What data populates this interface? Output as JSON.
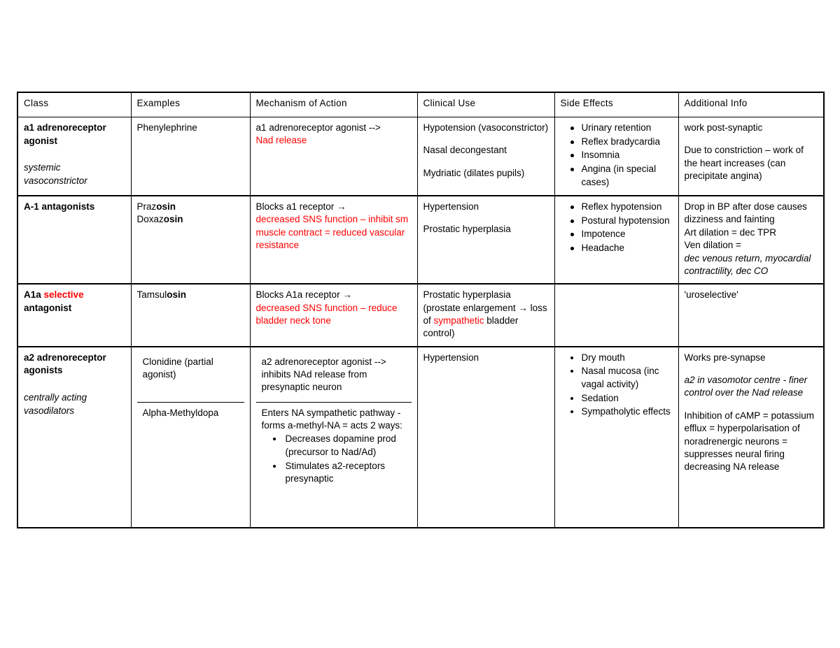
{
  "document": {
    "type": "reference-table",
    "accent_red": "#ff0000",
    "text_color": "#000000",
    "background": "#ffffff"
  },
  "table": {
    "headers": [
      "Class",
      "Examples",
      "Mechanism of Action",
      "Clinical Use",
      "Side Effects",
      "Additional Info"
    ],
    "rows": [
      {
        "class_title": "a1 adrenoreceptor agonist",
        "class_subtitle": "systemic vasoconstrictor",
        "examples": "Phenylephrine",
        "moa_black": "a1 adrenoreceptor agonist -->",
        "moa_red": "Nad release",
        "clinical_use": [
          "Hypotension (vasoconstrictor)",
          "Nasal decongestant",
          "Mydriatic (dilates pupils)"
        ],
        "side_effects": [
          "Urinary retention",
          "Reflex bradycardia",
          "Insomnia",
          "Angina (in special cases)"
        ],
        "additional_info": [
          "work post-synaptic",
          "Due to constriction – work of the heart increases (can precipitate angina)"
        ]
      },
      {
        "class_title": "A-1 antagonists",
        "examples_1_prefix": "Praz",
        "examples_1_bold": "osin",
        "examples_2_prefix": "Doxaz",
        "examples_2_bold": "osin",
        "moa_black": "Blocks a1 receptor →",
        "moa_red": "decreased SNS function – inhibit sm muscle contract = reduced vascular resistance",
        "clinical_use": [
          "Hypertension",
          "Prostatic hyperplasia"
        ],
        "side_effects": [
          "Reflex hypotension",
          "Postural hypotension",
          "Impotence",
          "Headache"
        ],
        "additional_plain": "Drop in BP after dose causes dizziness and fainting",
        "additional_line2": "Art dilation = dec TPR",
        "additional_line3": "Ven dilation =",
        "additional_italic": "dec venous return, myocardial contractility, dec CO"
      },
      {
        "class_title_part1": "A1a",
        "class_title_red": "selective",
        "class_title_part2": "antagonist",
        "examples_prefix": "Tamsul",
        "examples_bold": "osin",
        "moa_black": "Blocks A1a receptor →",
        "moa_red": "decreased SNS function – reduce bladder neck tone",
        "clinical_use_part1": "Prostatic hyperplasia (prostate enlargement → loss of ",
        "clinical_use_red": "sympathetic",
        "clinical_use_part2": " bladder control)",
        "side_effects": [],
        "additional_info": "'uroselective'"
      },
      {
        "class_title": "a2 adrenoreceptor agonists",
        "class_subtitle": "centrally acting vasodilators",
        "examples_a": "Clonidine (partial agonist)",
        "examples_b": "Alpha-Methyldopa",
        "moa_a": "a2 adrenoreceptor agonist --> inhibits NAd release from presynaptic neuron",
        "moa_b_intro": "Enters NA sympathetic pathway - forms a-methyl-NA = acts 2 ways:",
        "moa_b_bullets": [
          "Decreases dopamine prod (precursor to Nad/Ad)",
          "Stimulates a2-receptors presynaptic"
        ],
        "clinical_use": "Hypertension",
        "side_effects": [
          "Dry mouth",
          "Nasal mucosa (inc vagal activity)",
          "Sedation",
          "Sympatholytic effects"
        ],
        "additional_line1": "Works pre-synapse",
        "additional_italic": "a2 in vasomotor centre - finer control over the Nad release",
        "additional_line3": "Inhibition of cAMP = potassium efflux = hyperpolarisation of noradrenergic neurons = suppresses neural firing decreasing NA release"
      }
    ]
  }
}
